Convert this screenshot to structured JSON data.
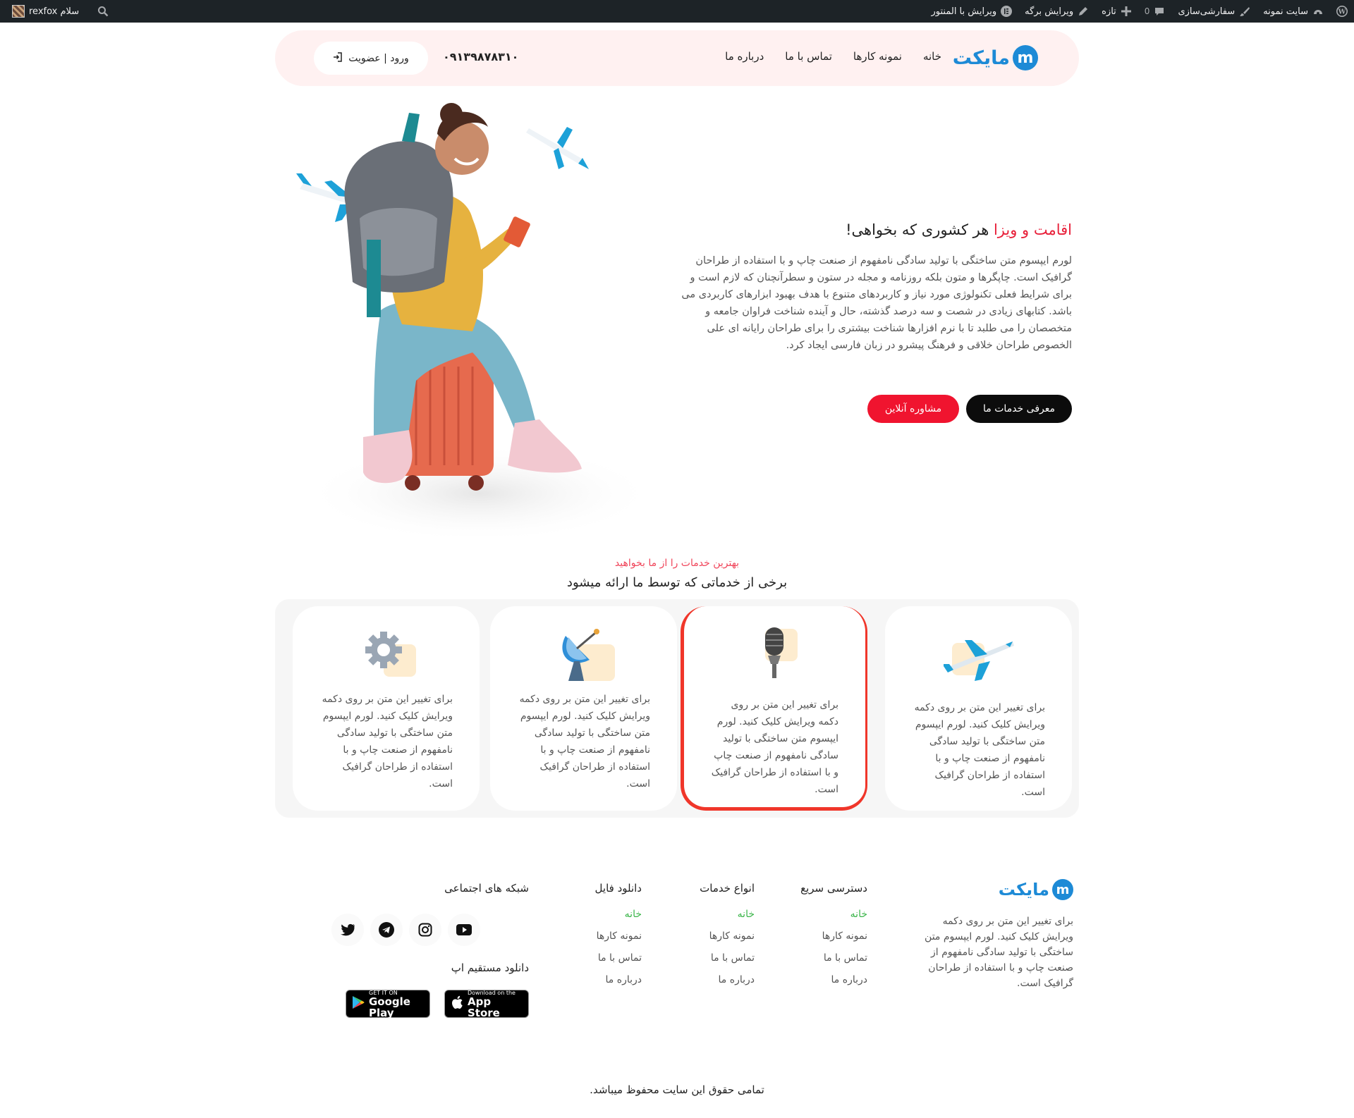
{
  "admin_bar": {
    "site_name": "سایت نمونه",
    "customize": "سفارشی‌سازی",
    "comments_count": "0",
    "new": "تازه",
    "edit_page": "ویرایش برگه",
    "edit_elementor": "ویرایش با المنتور",
    "greeting": "سلام rexfox"
  },
  "header": {
    "logo_text": "مایکت",
    "logo_mark": "m",
    "nav": [
      "خانه",
      "نمونه کارها",
      "تماس با ما",
      "درباره ما"
    ],
    "phone": "۰۹۱۳۹۸۷۸۳۱۰",
    "login": "ورود | عضویت"
  },
  "hero": {
    "title_accent": "اقامت و ویزا",
    "title_rest": " هر کشوری که بخواهی!",
    "body": "لورم ایپسوم متن ساختگی با تولید سادگی نامفهوم از صنعت چاپ و با استفاده از طراحان گرافیک است. چاپگرها و متون بلکه روزنامه و مجله در ستون و سطرآنچنان که لازم است و برای شرایط فعلی تکنولوژی مورد نیاز و کاربردهای متنوع با هدف بهبود ابزارهای کاربردی می باشد. کتابهای زیادی در شصت و سه درصد گذشته، حال و آینده شناخت فراوان جامعه و متخصصان را می طلبد تا با نرم افزارها شناخت بیشتری را برای طراحان رایانه ای علی الخصوص طراحان خلاقی و فرهنگ پیشرو در زبان فارسی ایجاد کرد.",
    "btn_services": "معرفی خدمات ما",
    "btn_consult": "مشاوره آنلاین"
  },
  "services": {
    "subtitle": "بهترین خدمات را از ما بخواهید",
    "title": "برخی از خدماتی که توسط ما ارائه میشود",
    "cards": [
      {
        "icon": "airplane-icon",
        "text": "برای تغییر این متن بر روی دکمه ویرایش کلیک کنید. لورم ایپسوم متن ساختگی با تولید سادگی نامفهوم از صنعت چاپ و با استفاده از طراحان گرافیک است."
      },
      {
        "icon": "microphone-icon",
        "text": "برای تغییر این متن بر روی دکمه ویرایش کلیک کنید. لورم ایپسوم متن ساختگی با تولید سادگی نامفهوم از صنعت چاپ و با استفاده از طراحان گرافیک است."
      },
      {
        "icon": "satellite-dish-icon",
        "text": "برای تغییر این متن بر روی دکمه ویرایش کلیک کنید. لورم ایپسوم متن ساختگی با تولید سادگی نامفهوم از صنعت چاپ و با استفاده از طراحان گرافیک است."
      },
      {
        "icon": "gear-icon",
        "text": "برای تغییر این متن بر روی دکمه ویرایش کلیک کنید. لورم ایپسوم متن ساختگی با تولید سادگی نامفهوم از صنعت چاپ و با استفاده از طراحان گرافیک است."
      }
    ]
  },
  "footer": {
    "logo_text": "مایکت",
    "about": "برای تغییر این متن بر روی دکمه ویرایش کلیک کنید. لورم ایپسوم متن ساختگی با تولید سادگی نامفهوم از صنعت چاپ و با استفاده از طراحان گرافیک است.",
    "columns": [
      {
        "title": "دسترسی سریع",
        "links": [
          "خانه",
          "نمونه کارها",
          "تماس با ما",
          "درباره ما"
        ]
      },
      {
        "title": "انواع خدمات",
        "links": [
          "خانه",
          "نمونه کارها",
          "تماس با ما",
          "درباره ما"
        ]
      },
      {
        "title": "دانلود فایل",
        "links": [
          "خانه",
          "نمونه کارها",
          "تماس با ما",
          "درباره ما"
        ]
      }
    ],
    "social_title": "شبکه های اجتماعی",
    "social": [
      "youtube-icon",
      "instagram-icon",
      "telegram-icon",
      "twitter-icon"
    ],
    "app_title": "دانلود مستقیم اپ",
    "app_store_small": "Download on the",
    "app_store_big": "App Store",
    "google_play_small": "GET IT ON",
    "google_play_big": "Google Play",
    "copyright": "تمامی حقوق این سایت محفوظ میباشد."
  },
  "colors": {
    "accent_red": "#f0142f",
    "brand_blue": "#1d8ad6",
    "link_green": "#3bb54a",
    "header_bg": "#fff1f1"
  }
}
